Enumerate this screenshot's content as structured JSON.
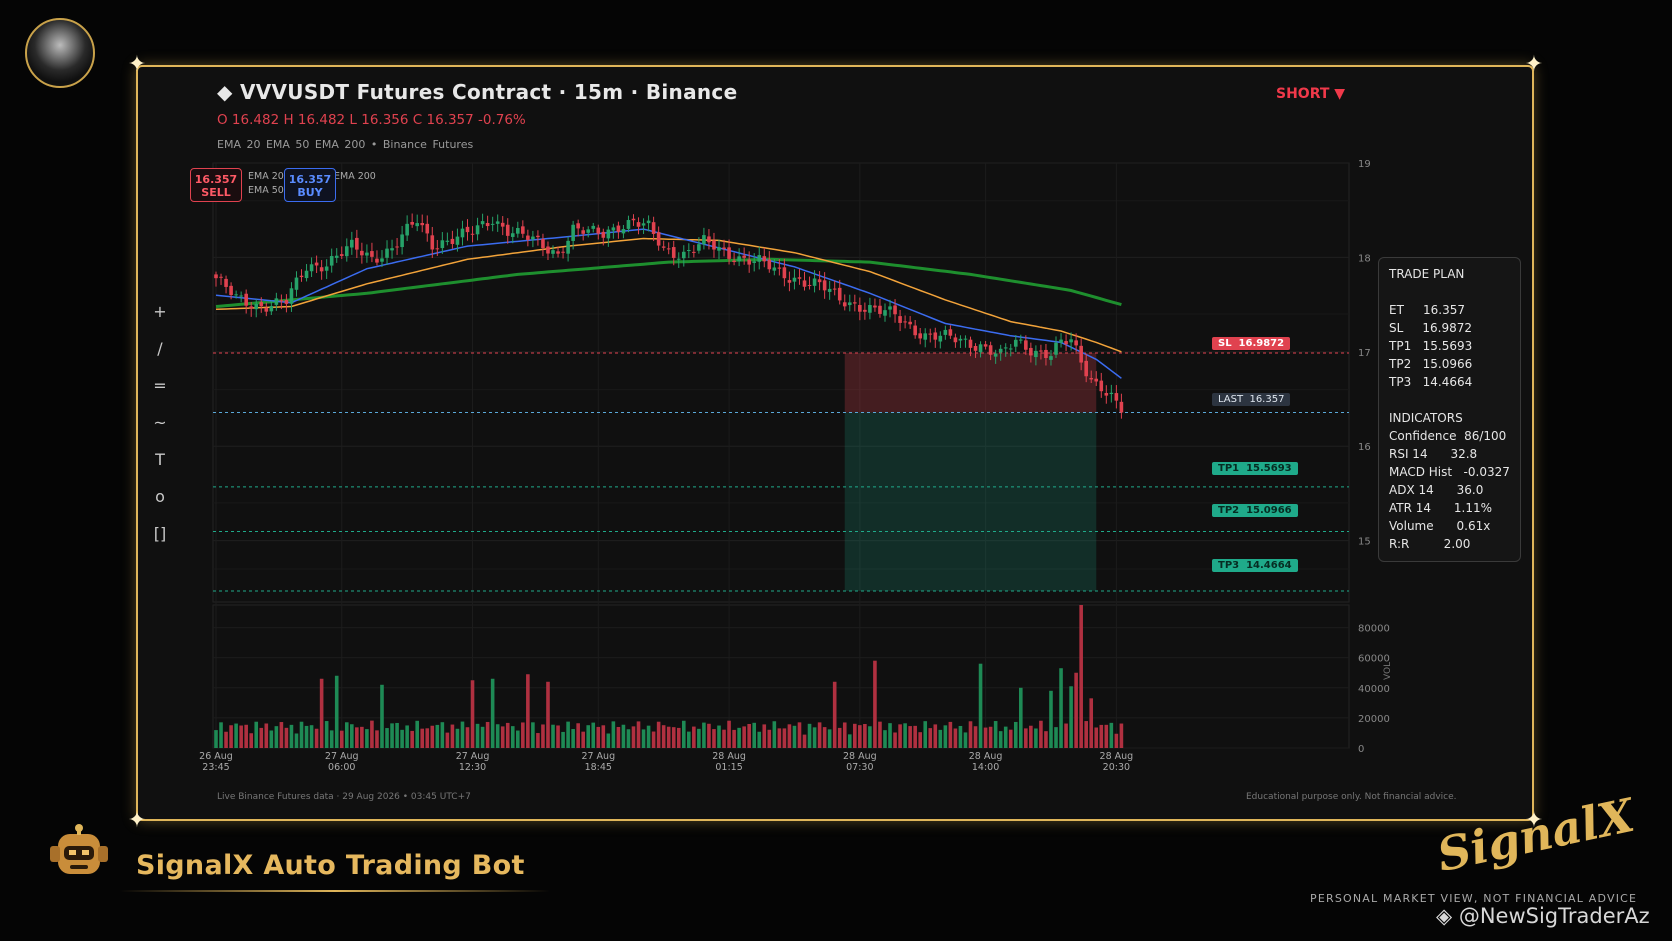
{
  "header": {
    "title": "◆  VVVUSDT Futures Contract  ·  15m  ·  Binance",
    "ohlc": "O 16.482   H 16.482   L 16.356   C 16.357   -0.76%",
    "emas": "EMA 20     EMA 50     EMA 200     •     Binance Futures",
    "direction": "SHORT ▼"
  },
  "quote": {
    "sell_price": "16.357",
    "sell_label": "SELL",
    "buy_price": "16.357",
    "buy_label": "BUY",
    "legend": [
      "EMA 20",
      "EMA 50",
      "EMA 200"
    ]
  },
  "toolbar": [
    "+",
    "/",
    "=",
    "~",
    "T",
    "o",
    "[]"
  ],
  "levels": {
    "sl": {
      "label": "SL  16.9872",
      "value": 16.9872
    },
    "last": {
      "label": "LAST  16.357",
      "value": 16.357
    },
    "tp1": {
      "label": "TP1  15.5693",
      "value": 15.5693
    },
    "tp2": {
      "label": "TP2  15.0966",
      "value": 15.0966
    },
    "tp3": {
      "label": "TP3  14.4664",
      "value": 14.4664
    }
  },
  "trade_plan": {
    "title": "TRADE PLAN",
    "rows": [
      "ET     16.357",
      "SL     16.9872",
      "TP1   15.5693",
      "TP2   15.0966",
      "TP3   14.4664"
    ],
    "indicators_title": "INDICATORS",
    "indicators": [
      "Confidence  86/100",
      "RSI 14      32.8",
      "MACD Hist   -0.0327",
      "ADX 14      36.0",
      "ATR 14      1.11%",
      "Volume      0.61x",
      "R:R         2.00"
    ]
  },
  "footer": {
    "left": "Live Binance Futures data   ·   29 Aug 2026  •  03:45 UTC+7",
    "right": "Educational purpose only. Not financial advice."
  },
  "brand": {
    "bot_name": "SignalX Auto Trading Bot",
    "logo_text": "SignalX",
    "disclaimer": "PERSONAL MARKET VIEW, NOT FINANCIAL ADVICE",
    "handle": "◈ @NewSigTraderAz"
  },
  "colors": {
    "up": "#26a269",
    "down": "#e0424f",
    "ema20": "#3b6cf0",
    "ema50": "#f2a33a",
    "ema200": "#1e8f2e",
    "gold": "#e0b65a"
  },
  "chart_data": {
    "type": "candlestick",
    "symbol": "VVVUSDT",
    "interval": "15m",
    "xlabel": "",
    "ylabel": "",
    "volume_label": "VOL",
    "ylim": [
      14.35,
      19.0
    ],
    "volume_ylim": [
      0,
      95000
    ],
    "price_ticks": [
      15,
      16,
      17,
      18,
      19
    ],
    "volume_ticks": [
      0,
      20000,
      40000,
      60000,
      80000
    ],
    "x_ticks": [
      {
        "index": 0,
        "label": [
          "26 Aug",
          "23:45"
        ]
      },
      {
        "index": 25,
        "label": [
          "27 Aug",
          "06:00"
        ]
      },
      {
        "index": 51,
        "label": [
          "27 Aug",
          "12:30"
        ]
      },
      {
        "index": 76,
        "label": [
          "27 Aug",
          "18:45"
        ]
      },
      {
        "index": 102,
        "label": [
          "28 Aug",
          "01:15"
        ]
      },
      {
        "index": 128,
        "label": [
          "28 Aug",
          "07:30"
        ]
      },
      {
        "index": 153,
        "label": [
          "28 Aug",
          "14:00"
        ]
      },
      {
        "index": 179,
        "label": [
          "28 Aug",
          "20:30"
        ]
      }
    ],
    "close_path": [
      [
        0,
        17.78
      ],
      [
        4,
        17.55
      ],
      [
        8,
        17.5
      ],
      [
        14,
        17.52
      ],
      [
        18,
        17.9
      ],
      [
        22,
        17.95
      ],
      [
        27,
        18.1
      ],
      [
        31,
        18.0
      ],
      [
        35,
        18.1
      ],
      [
        40,
        18.38
      ],
      [
        43,
        18.15
      ],
      [
        47,
        18.2
      ],
      [
        51,
        18.25
      ],
      [
        55,
        18.42
      ],
      [
        58,
        18.3
      ],
      [
        61,
        18.22
      ],
      [
        65,
        18.12
      ],
      [
        68,
        18.05
      ],
      [
        71,
        18.3
      ],
      [
        74,
        18.25
      ],
      [
        77,
        18.25
      ],
      [
        80,
        18.35
      ],
      [
        83,
        18.38
      ],
      [
        86,
        18.3
      ],
      [
        89,
        18.08
      ],
      [
        93,
        18.05
      ],
      [
        97,
        18.15
      ],
      [
        101,
        18.05
      ],
      [
        105,
        18.0
      ],
      [
        108,
        17.95
      ],
      [
        112,
        17.82
      ],
      [
        116,
        17.78
      ],
      [
        120,
        17.7
      ],
      [
        124,
        17.55
      ],
      [
        128,
        17.5
      ],
      [
        132,
        17.42
      ],
      [
        135,
        17.38
      ],
      [
        138,
        17.28
      ],
      [
        141,
        17.18
      ],
      [
        144,
        17.15
      ],
      [
        148,
        17.12
      ],
      [
        152,
        17.08
      ],
      [
        156,
        16.95
      ],
      [
        159,
        17.1
      ],
      [
        163,
        17.02
      ],
      [
        166,
        16.98
      ],
      [
        168,
        17.08
      ],
      [
        170,
        17.1
      ],
      [
        172,
        16.9
      ],
      [
        174,
        16.72
      ],
      [
        176,
        16.65
      ],
      [
        178,
        16.52
      ],
      [
        180,
        16.357
      ]
    ],
    "ema20_path": [
      [
        0,
        17.6
      ],
      [
        15,
        17.52
      ],
      [
        30,
        17.88
      ],
      [
        50,
        18.12
      ],
      [
        70,
        18.22
      ],
      [
        85,
        18.3
      ],
      [
        100,
        18.1
      ],
      [
        115,
        17.9
      ],
      [
        130,
        17.62
      ],
      [
        145,
        17.3
      ],
      [
        158,
        17.17
      ],
      [
        168,
        17.1
      ],
      [
        175,
        16.92
      ],
      [
        180,
        16.72
      ]
    ],
    "ema50_path": [
      [
        0,
        17.45
      ],
      [
        15,
        17.48
      ],
      [
        30,
        17.72
      ],
      [
        50,
        17.98
      ],
      [
        70,
        18.12
      ],
      [
        85,
        18.2
      ],
      [
        100,
        18.18
      ],
      [
        115,
        18.05
      ],
      [
        130,
        17.85
      ],
      [
        145,
        17.55
      ],
      [
        158,
        17.32
      ],
      [
        168,
        17.22
      ],
      [
        175,
        17.1
      ],
      [
        180,
        17.0
      ]
    ],
    "ema200_path": [
      [
        0,
        17.48
      ],
      [
        30,
        17.62
      ],
      [
        60,
        17.82
      ],
      [
        90,
        17.95
      ],
      [
        110,
        17.98
      ],
      [
        130,
        17.95
      ],
      [
        150,
        17.82
      ],
      [
        170,
        17.65
      ],
      [
        180,
        17.5
      ]
    ],
    "volume_spikes": [
      {
        "index": 21,
        "value": 46000
      },
      {
        "index": 24,
        "value": 48000
      },
      {
        "index": 33,
        "value": 42000
      },
      {
        "index": 51,
        "value": 45000
      },
      {
        "index": 55,
        "value": 46000
      },
      {
        "index": 62,
        "value": 49000
      },
      {
        "index": 66,
        "value": 44000
      },
      {
        "index": 123,
        "value": 44000
      },
      {
        "index": 131,
        "value": 58000
      },
      {
        "index": 152,
        "value": 56000
      },
      {
        "index": 160,
        "value": 40000
      },
      {
        "index": 166,
        "value": 38000
      },
      {
        "index": 168,
        "value": 53000
      },
      {
        "index": 170,
        "value": 41000
      },
      {
        "index": 171,
        "value": 50000
      },
      {
        "index": 172,
        "value": 95000
      },
      {
        "index": 174,
        "value": 33000
      }
    ],
    "volume_base": 14000
  }
}
